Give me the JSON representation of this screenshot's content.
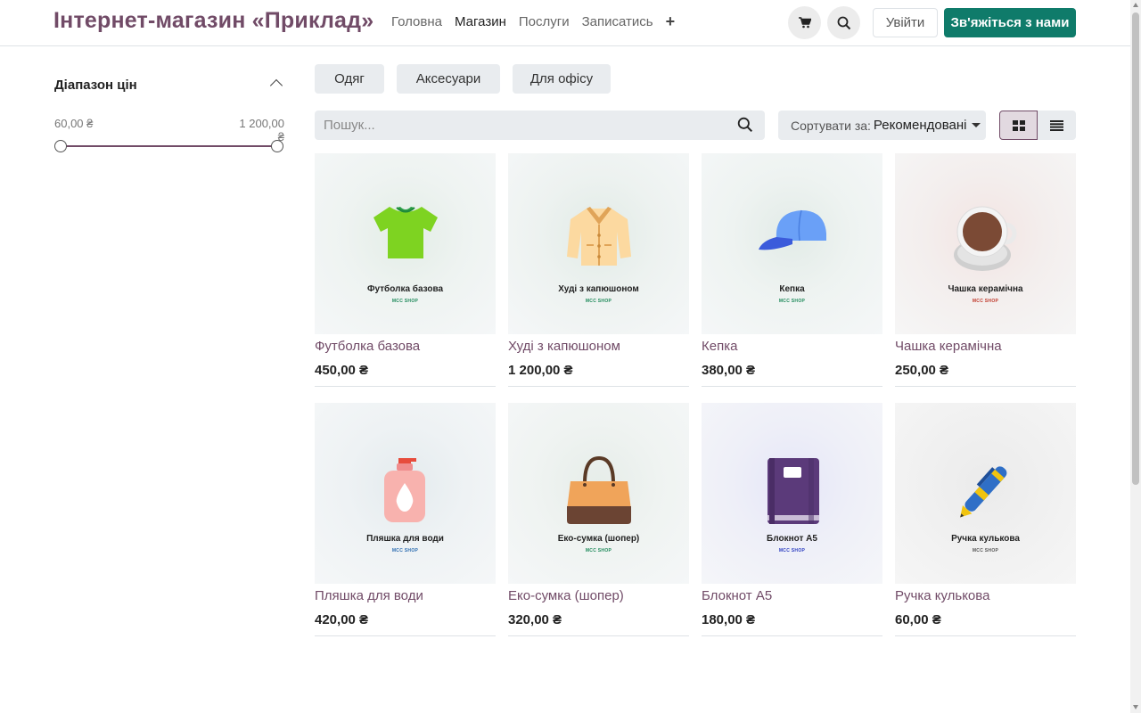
{
  "header": {
    "brand": "Інтернет-магазин «Приклад»",
    "nav": [
      {
        "label": "Головна",
        "active": false
      },
      {
        "label": "Магазин",
        "active": true
      },
      {
        "label": "Послуги",
        "active": false
      },
      {
        "label": "Записатись",
        "active": false
      }
    ],
    "plus_icon": "plus-icon",
    "cart_icon": "cart-icon",
    "search_icon": "search-icon",
    "login_label": "Увійти",
    "contact_label": "Зв'яжіться з нами",
    "accent_color": "#714b67",
    "contact_color": "#0f7b6a"
  },
  "sidebar": {
    "price_title": "Діапазон цін",
    "price_min": "60,00 ₴",
    "price_max": "1 200,00 ₴"
  },
  "categories": [
    "Одяг",
    "Аксесуари",
    "Для офісу"
  ],
  "search": {
    "placeholder": "Пошук..."
  },
  "sort": {
    "label": "Сортувати за:",
    "value": "Рекомендовані"
  },
  "view": {
    "active": "grid"
  },
  "products": [
    {
      "name": "Футболка базова",
      "price": "450,00 ₴",
      "caption": "Футболка базова",
      "sub": "MCC SHOP",
      "icon": "tshirt-icon",
      "sub_color": "#1e8a5a"
    },
    {
      "name": "Худі з капюшоном",
      "price": "1 200,00 ₴",
      "caption": "Худі з капюшоном",
      "sub": "MCC SHOP",
      "icon": "coat-icon",
      "sub_color": "#1e8a5a"
    },
    {
      "name": "Кепка",
      "price": "380,00 ₴",
      "caption": "Кепка",
      "sub": "MCC SHOP",
      "icon": "cap-icon",
      "sub_color": "#1e8a5a"
    },
    {
      "name": "Чашка керамічна",
      "price": "250,00 ₴",
      "caption": "Чашка керамічна",
      "sub": "MCC SHOP",
      "icon": "mug-icon",
      "sub_color": "#c0392b"
    },
    {
      "name": "Пляшка для води",
      "price": "420,00 ₴",
      "caption": "Пляшка для води",
      "sub": "MCC SHOP",
      "icon": "bottle-icon",
      "sub_color": "#2b6cb0"
    },
    {
      "name": "Еко-сумка (шопер)",
      "price": "320,00 ₴",
      "caption": "Еко-сумка (шопер)",
      "sub": "MCC SHOP",
      "icon": "bag-icon",
      "sub_color": "#1e8a5a"
    },
    {
      "name": "Блокнот А5",
      "price": "180,00 ₴",
      "caption": "Блокнот А5",
      "sub": "MCC SHOP",
      "icon": "notebook-icon",
      "sub_color": "#2b3cc0"
    },
    {
      "name": "Ручка кулькова",
      "price": "60,00 ₴",
      "caption": "Ручка кулькова",
      "sub": "MCC SHOP",
      "icon": "pen-icon",
      "sub_color": "#555555"
    }
  ]
}
